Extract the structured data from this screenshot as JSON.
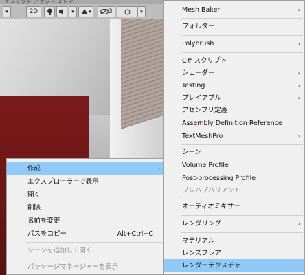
{
  "toolbar": {
    "top_text": "エフェクト   アセット   ストア",
    "mode_2d": "2D",
    "hidden_count": "3",
    "icons": [
      "light-bulb-icon",
      "audio-icon",
      "effects-icon",
      "visibility-icon"
    ]
  },
  "right_menu": {
    "items": [
      {
        "label": "Mesh Baker",
        "arrow": true,
        "disabled": false,
        "highlight": false
      },
      {
        "label": "フォルダー",
        "arrow": false,
        "disabled": false,
        "highlight": false
      },
      {
        "label": "Polybrush",
        "arrow": true,
        "disabled": false,
        "highlight": false
      },
      {
        "label": "C# スクリプト",
        "arrow": false,
        "disabled": false,
        "highlight": false
      },
      {
        "label": "シェーダー",
        "arrow": true,
        "disabled": false,
        "highlight": false
      },
      {
        "label": "Testing",
        "arrow": true,
        "disabled": false,
        "highlight": false
      },
      {
        "label": "プレイアブル",
        "arrow": true,
        "disabled": false,
        "highlight": false
      },
      {
        "label": "アセンブリ定義",
        "arrow": false,
        "disabled": false,
        "highlight": false
      },
      {
        "label": "Assembly Definition Reference",
        "arrow": false,
        "disabled": false,
        "highlight": false
      },
      {
        "label": "TextMeshPro",
        "arrow": true,
        "disabled": false,
        "highlight": false
      },
      {
        "label": "シーン",
        "arrow": false,
        "disabled": false,
        "highlight": false
      },
      {
        "label": "Volume Profile",
        "arrow": false,
        "disabled": false,
        "highlight": false
      },
      {
        "label": "Post-processing Profile",
        "arrow": false,
        "disabled": false,
        "highlight": false
      },
      {
        "label": "プレハブバリアント",
        "arrow": false,
        "disabled": true,
        "highlight": false
      },
      {
        "label": "オーディオミキサー",
        "arrow": false,
        "disabled": false,
        "highlight": false
      },
      {
        "label": "レンダリング",
        "arrow": true,
        "disabled": false,
        "highlight": false
      },
      {
        "label": "マテリアル",
        "arrow": false,
        "disabled": false,
        "highlight": false
      },
      {
        "label": "レンズフレア",
        "arrow": false,
        "disabled": false,
        "highlight": false
      },
      {
        "label": "レンダーテクスチャ",
        "arrow": false,
        "disabled": false,
        "highlight": true
      }
    ]
  },
  "left_menu": {
    "items": [
      {
        "label": "作成",
        "arrow": true,
        "disabled": false,
        "highlight": true,
        "shortcut": ""
      },
      {
        "label": "エクスプローラーで表示",
        "arrow": false,
        "disabled": false,
        "highlight": false,
        "shortcut": ""
      },
      {
        "label": "開く",
        "arrow": false,
        "disabled": false,
        "highlight": false,
        "shortcut": ""
      },
      {
        "label": "削除",
        "arrow": false,
        "disabled": false,
        "highlight": false,
        "shortcut": ""
      },
      {
        "label": "名前を変更",
        "arrow": false,
        "disabled": false,
        "highlight": false,
        "shortcut": ""
      },
      {
        "label": "パスをコピー",
        "arrow": false,
        "disabled": false,
        "highlight": false,
        "shortcut": "Alt+Ctrl+C"
      },
      {
        "label": "シーンを追加して開く",
        "arrow": false,
        "disabled": true,
        "highlight": false,
        "shortcut": ""
      },
      {
        "label": "パッケージマネージャーを表示",
        "arrow": false,
        "disabled": true,
        "highlight": false,
        "shortcut": ""
      }
    ]
  },
  "colors": {
    "highlight": "#91c9f7",
    "menu_bg": "#f0f0f0",
    "disabled_text": "#8d8d8d"
  }
}
